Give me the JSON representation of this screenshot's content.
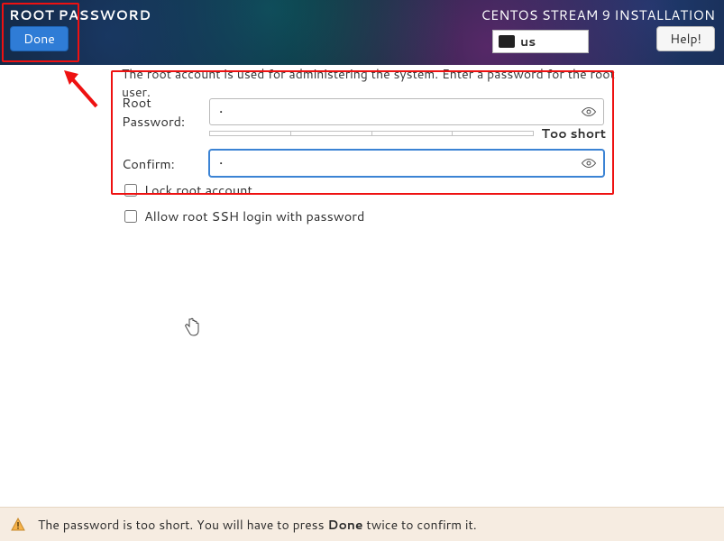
{
  "header": {
    "title": "ROOT PASSWORD",
    "subtitle": "CENTOS STREAM 9 INSTALLATION",
    "done_label": "Done",
    "help_label": "Help!",
    "keyboard_layout": "us"
  },
  "form": {
    "explain": "The root account is used for administering the system.  Enter a password for the root user.",
    "password_label": "Root Password:",
    "password_value": "•",
    "confirm_label": "Confirm:",
    "confirm_value": "•",
    "strength_text": "Too short",
    "lock_label": "Lock root account",
    "lock_checked": false,
    "ssh_label": "Allow root SSH login with password",
    "ssh_checked": false
  },
  "warning": {
    "text_before": "The password is too short. You will have to press ",
    "bold": "Done",
    "text_after": " twice to confirm it."
  }
}
